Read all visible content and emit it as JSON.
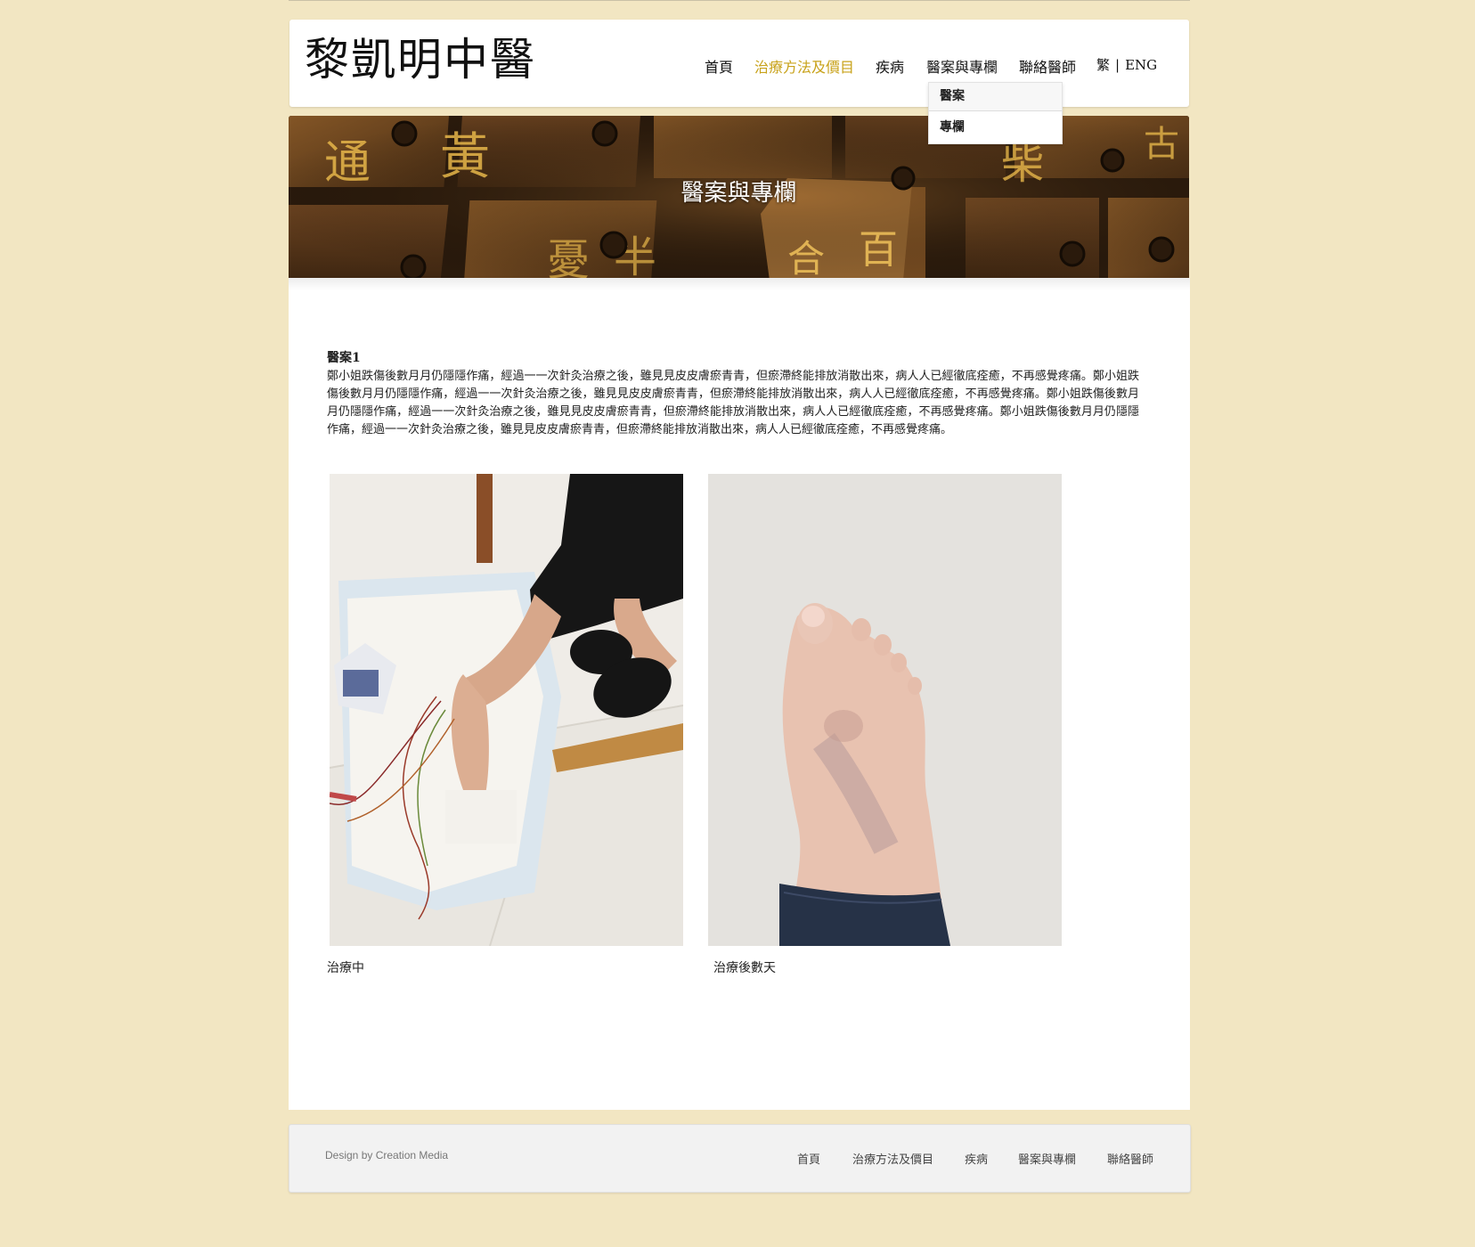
{
  "site": {
    "logo": "黎凱明中醫"
  },
  "nav": {
    "items": [
      {
        "label": "首頁",
        "active": false
      },
      {
        "label": "治療方法及價目",
        "active": true
      },
      {
        "label": "疾病",
        "active": false
      },
      {
        "label": "醫案與專欄",
        "active": false
      },
      {
        "label": "聯絡醫師",
        "active": false
      }
    ],
    "lang_zh": "繁",
    "lang_sep": "|",
    "lang_en": "ENG",
    "dropdown": [
      "醫案",
      "專欄"
    ],
    "active_color": "#c8a21a"
  },
  "banner": {
    "title": "醫案與專欄"
  },
  "case": {
    "title": "醫案1",
    "body": "鄭小姐跌傷後數月月仍隱隱作痛，經過一一次針灸治療之後，雖見見皮皮膚瘀青青，但瘀滯終能排放消散出來，病人人已經徹底痊癒，不再感覺疼痛。鄭小姐跌傷後數月月仍隱隱作痛，經過一一次針灸治療之後，雖見見皮皮膚瘀青青，但瘀滯終能排放消散出來，病人人已經徹底痊癒，不再感覺疼痛。鄭小姐跌傷後數月月仍隱隱作痛，經過一一次針灸治療之後，雖見見皮皮膚瘀青青，但瘀滯終能排放消散出來，病人人已經徹底痊癒，不再感覺疼痛。鄭小姐跌傷後數月月仍隱隱作痛，經過一一次針灸治療之後，雖見見皮皮膚瘀青青，但瘀滯終能排放消散出來，病人人已經徹底痊癒，不再感覺疼痛。",
    "photos": [
      {
        "caption": "治療中"
      },
      {
        "caption": "治療後數天"
      }
    ]
  },
  "footer": {
    "credit": "Design by Creation Media",
    "links": [
      "首頁",
      "治療方法及價目",
      "疾病",
      "醫案與專欄",
      "聯絡醫師"
    ]
  },
  "colors": {
    "background": "#f2e6c2",
    "accent": "#c8a21a"
  }
}
